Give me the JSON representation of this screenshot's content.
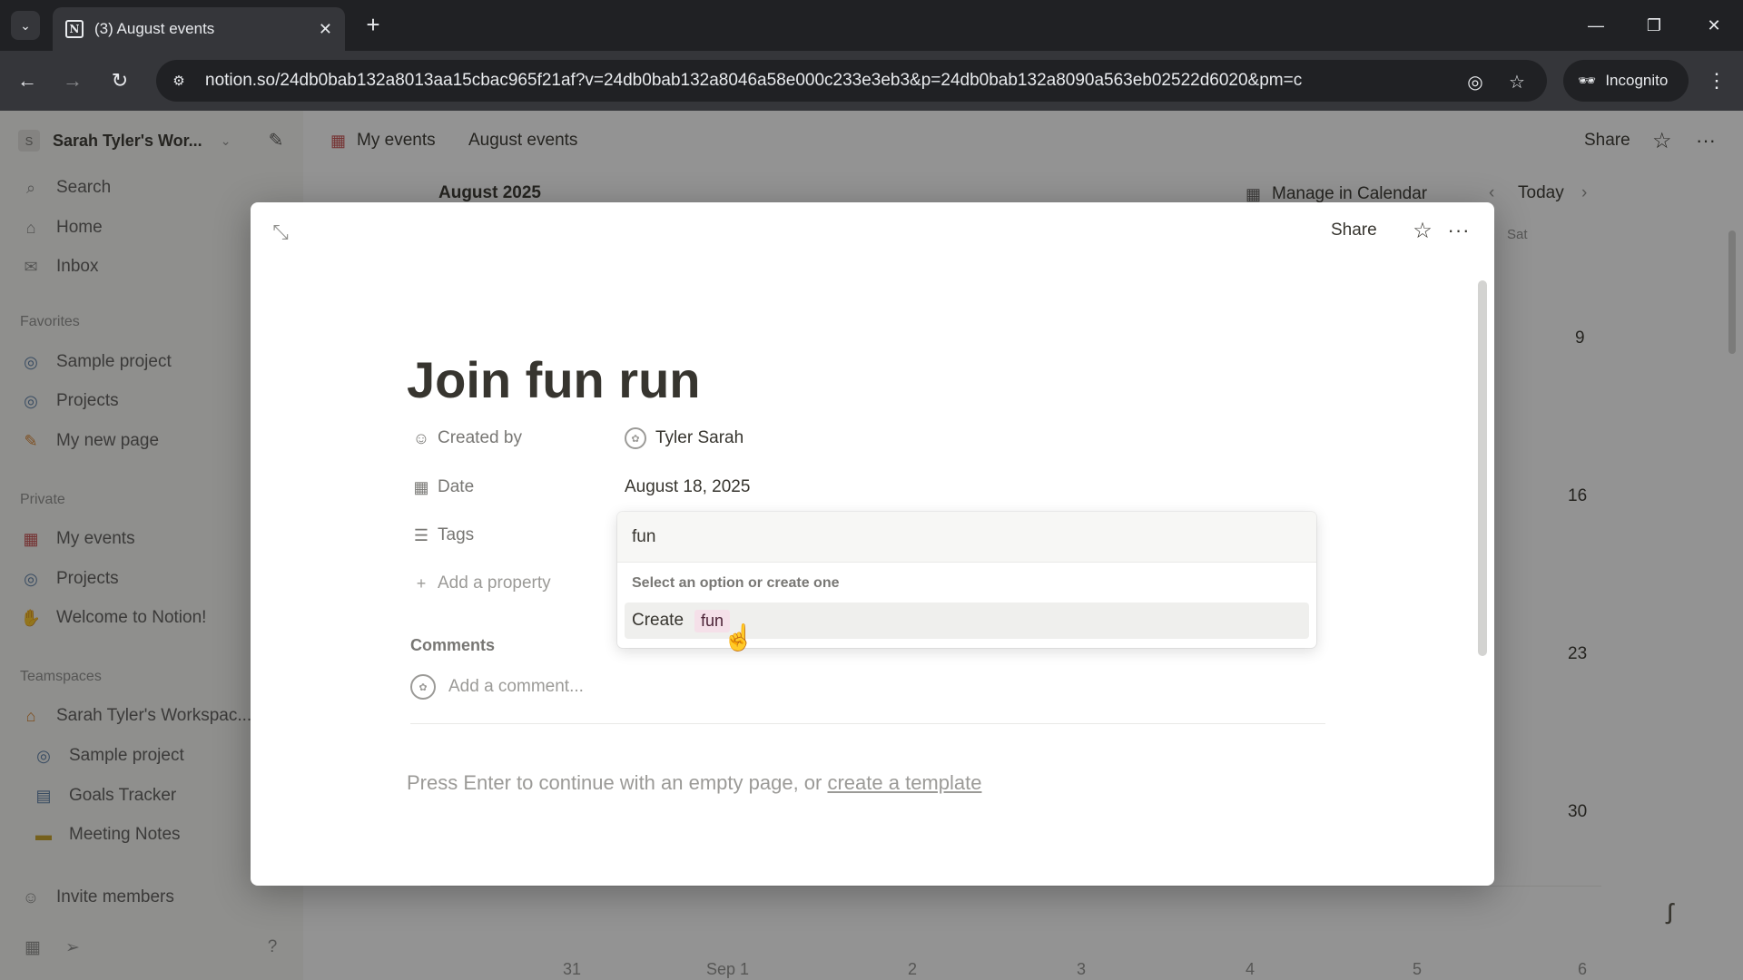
{
  "browser": {
    "tab_title": "(3) August events",
    "tab_favicon": "N",
    "url": "notion.so/24db0bab132a8013aa15cbac965f21af?v=24db0bab132a8046a58e000c233e3eb3&p=24db0bab132a8090a563eb02522d6020&pm=c",
    "incognito_label": "Incognito"
  },
  "sidebar": {
    "workspace_initial": "S",
    "workspace_name": "Sarah Tyler's Wor...",
    "top_items": [
      {
        "label": "Search",
        "icon": "search-icon"
      },
      {
        "label": "Home",
        "icon": "home-icon"
      },
      {
        "label": "Inbox",
        "icon": "inbox-icon"
      }
    ],
    "favorites_label": "Favorites",
    "favorites": [
      {
        "label": "Sample project",
        "icon": "target-icon"
      },
      {
        "label": "Projects",
        "icon": "target-icon"
      },
      {
        "label": "My new page",
        "icon": "pencil-icon"
      }
    ],
    "private_label": "Private",
    "private": [
      {
        "label": "My events",
        "icon": "calendar-icon"
      },
      {
        "label": "Projects",
        "icon": "target-icon"
      },
      {
        "label": "Welcome to Notion!",
        "icon": "wave-icon"
      }
    ],
    "teamspaces_label": "Teamspaces",
    "teamspaces": [
      {
        "label": "Sarah Tyler's Workspac...",
        "icon": "house-icon"
      },
      {
        "label": "Sample project",
        "icon": "target-icon"
      },
      {
        "label": "Goals Tracker",
        "icon": "chart-icon"
      },
      {
        "label": "Meeting Notes",
        "icon": "folder-icon"
      }
    ],
    "invite_label": "Invite members"
  },
  "topbar": {
    "crumb_1": "My events",
    "crumb_2": "August events",
    "share_label": "Share"
  },
  "calendar": {
    "month_label": "August 2025",
    "manage_label": "Manage in Calendar",
    "today_label": "Today",
    "sat_label": "Sat",
    "right_col_days": [
      "9",
      "16",
      "23",
      "30"
    ],
    "bottom_row_days": [
      "31",
      "Sep 1",
      "2",
      "3",
      "4",
      "5",
      "6"
    ]
  },
  "modal": {
    "share_label": "Share",
    "title": "Join fun run",
    "properties": {
      "created_by_label": "Created by",
      "created_by_value": "Tyler Sarah",
      "date_label": "Date",
      "date_value": "August 18, 2025",
      "tags_label": "Tags",
      "add_property_label": "Add a property"
    },
    "comments_label": "Comments",
    "comment_placeholder": "Add a comment...",
    "hint_text": "Press Enter to continue with an empty page, or",
    "hint_link": "create a template"
  },
  "tags_dropdown": {
    "input_value": "fun",
    "hint": "Select an option or create one",
    "create_label": "Create",
    "new_tag": "fun",
    "tag_color": "#f5e0e9"
  }
}
